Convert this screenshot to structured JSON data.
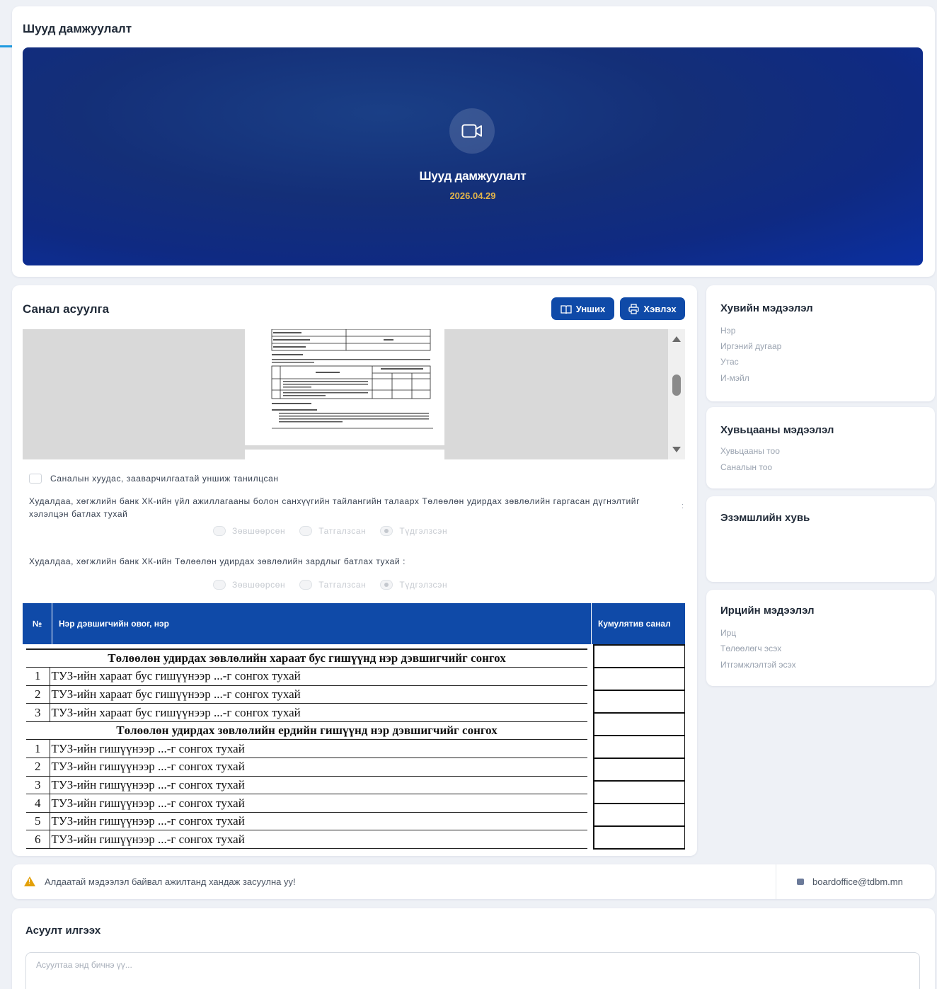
{
  "live": {
    "section_title": "Шууд дамжуулалт",
    "video_title": "Шууд дамжуулалт",
    "video_date": "2026.04.29",
    "icon": "video-camera-icon"
  },
  "survey": {
    "title": "Санал асуулга",
    "read_button": "Унших",
    "print_button": "Хэвлэх",
    "acknowledge_label": "Саналын хуудас, зааварчилгаатай уншиж танилцсан",
    "questions": [
      {
        "text": "Худалдаа, хөгжлийн банк ХК-ийн үйл ажиллагааны болон санхүүгийн тайлангийн талаарх Төлөөлөн удирдах зөвлөлийн гаргасан дүгнэлтийг хэлэлцэн батлах тухай",
        "suffix": ":",
        "options": [
          "Зөвшөөрсөн",
          "Татгалзсан",
          "Түдгэлзсэн"
        ],
        "selected": "Түдгэлзсэн"
      },
      {
        "text": "Худалдаа, хөгжлийн банк ХК-ийн Төлөөлөн удирдах зөвлөлийн зардлыг батлах тухай :",
        "options": [
          "Зөвшөөрсөн",
          "Татгалзсан",
          "Түдгэлзсэн"
        ],
        "selected": "Түдгэлзсэн"
      }
    ],
    "candidate_table": {
      "col_no": "№",
      "col_name": "Нэр дэвшигчийн овог, нэр",
      "col_vote": "Кумулятив санал",
      "rows": [
        {
          "type": "section",
          "text": "Төлөөлөн удирдах зөвлөлийн хараат бус гишүүнд нэр дэвшигчийг сонгох"
        },
        {
          "type": "item",
          "num": "1",
          "text": "ТУЗ-ийн хараат бус гишүүнээр ...-г сонгох тухай"
        },
        {
          "type": "item",
          "num": "2",
          "text": "ТУЗ-ийн хараат бус гишүүнээр ...-г сонгох тухай"
        },
        {
          "type": "item",
          "num": "3",
          "text": "ТУЗ-ийн хараат бус гишүүнээр ...-г сонгох тухай"
        },
        {
          "type": "section",
          "text": "Төлөөлөн удирдах зөвлөлийн ердийн гишүүнд нэр дэвшигчийг сонгох"
        },
        {
          "type": "item",
          "num": "1",
          "text": "ТУЗ-ийн гишүүнээр ...-г сонгох тухай"
        },
        {
          "type": "item",
          "num": "2",
          "text": "ТУЗ-ийн гишүүнээр ...-г сонгох тухай"
        },
        {
          "type": "item",
          "num": "3",
          "text": "ТУЗ-ийн гишүүнээр ...-г сонгох тухай"
        },
        {
          "type": "item",
          "num": "4",
          "text": "ТУЗ-ийн гишүүнээр ...-г сонгох тухай"
        },
        {
          "type": "item",
          "num": "5",
          "text": "ТУЗ-ийн гишүүнээр ...-г сонгох тухай"
        },
        {
          "type": "item",
          "num": "6",
          "text": "ТУЗ-ийн гишүүнээр ...-г сонгох тухай"
        }
      ]
    }
  },
  "personal": {
    "title": "Хувийн мэдээлэл",
    "fields": [
      "Нэр",
      "Иргэний дугаар",
      "Утас",
      "И-мэйл"
    ]
  },
  "shares": {
    "title": "Хувьцааны мэдээлэл",
    "fields": [
      "Хувьцааны тоо",
      "Саналын тоо"
    ]
  },
  "ownership": {
    "title": "Эзэмшлийн хувь"
  },
  "attendance": {
    "title": "Ирцийн мэдээлэл",
    "fields": [
      "Ирц",
      "Төлөөлөгч эсэх",
      "Итгэмжлэлтэй эсэх"
    ]
  },
  "info_bar": {
    "warning": "Алдаатай мэдээлэл байвал ажилтанд хандаж засуулна уу!",
    "email": "boardoffice@tdbm.mn"
  },
  "ask": {
    "title": "Асуулт илгээх",
    "placeholder": "Асуултаа энд бичнэ үү..."
  },
  "colors": {
    "primary": "#0f4aa8",
    "video_bg": "#142f78",
    "date_accent": "#e2b44a",
    "warning": "#e3a008"
  }
}
